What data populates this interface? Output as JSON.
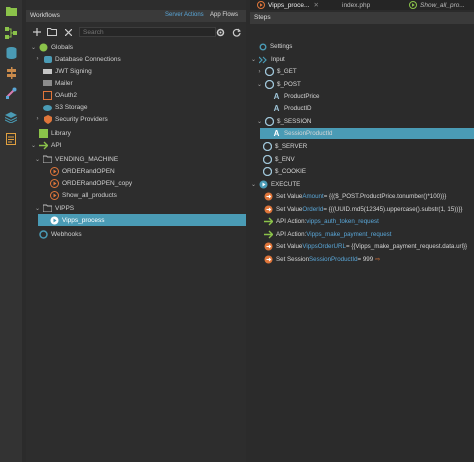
{
  "activity_bar": {
    "icons": [
      "folder-icon",
      "workflow-icon",
      "database-icon",
      "signpost-icon",
      "tools-icon",
      "layers-icon",
      "tasks-icon"
    ]
  },
  "left_panel": {
    "title": "Workflows",
    "server_actions": "Server Actions",
    "app_flows": "App Flows",
    "search_placeholder": "Search",
    "tree": {
      "globals": "Globals",
      "database_connections": "Database Connections",
      "jwt_signing": "JWT Signing",
      "mailer": "Mailer",
      "oauth2": "OAuth2",
      "s3_storage": "S3 Storage",
      "security_providers": "Security Providers",
      "library": "Library",
      "api": "API",
      "vending_machine": "VENDING_MACHINE",
      "order_and_open": "ORDERandOPEN",
      "order_and_open_copy": "ORDERandOPEN_copy",
      "show_all_products": "Show_all_products",
      "vipps": "VIPPS",
      "vipps_process": "Vipps_process",
      "webhooks": "Webhooks"
    }
  },
  "tabs": [
    {
      "label": "Vipps_proce..."
    },
    {
      "label": "index.php"
    },
    {
      "label": "Show_all_pro..."
    }
  ],
  "right_panel": {
    "title": "Steps",
    "settings": "Settings",
    "input": "Input",
    "get": "$_GET",
    "post": "$_POST",
    "product_price": "ProductPrice",
    "product_id": "ProductID",
    "session": "$_SESSION",
    "session_product_id": "SessionProductId",
    "server": "$_SERVER",
    "env": "$_ENV",
    "cookie": "$_COOKIE",
    "execute": "EXECUTE",
    "steps": [
      {
        "prefix": "Set Value ",
        "name": "Amount",
        "suffix": " = {{($_POST.ProductPrice.tonumber()*100)}}"
      },
      {
        "prefix": "Set Value ",
        "name": "OrderId",
        "suffix": " = {{(UUID.md5(12345).uppercase().substr(1, 15))}}"
      },
      {
        "prefix": "API Action: ",
        "name": "vipps_auth_token_request",
        "suffix": ""
      },
      {
        "prefix": "API Action: ",
        "name": "Vipps_make_payment_request",
        "suffix": ""
      },
      {
        "prefix": "Set Value ",
        "name": "VippsOrderURL",
        "suffix": " = {{Vipps_make_payment_request.data.url}}"
      },
      {
        "prefix": "Set Session ",
        "name": "SessionProductId",
        "suffix": " = 999"
      }
    ]
  },
  "colors": {
    "accent": "#4a9bb5",
    "link": "#5aa7d8",
    "orange": "#e0763a",
    "green": "#8bc34a"
  }
}
